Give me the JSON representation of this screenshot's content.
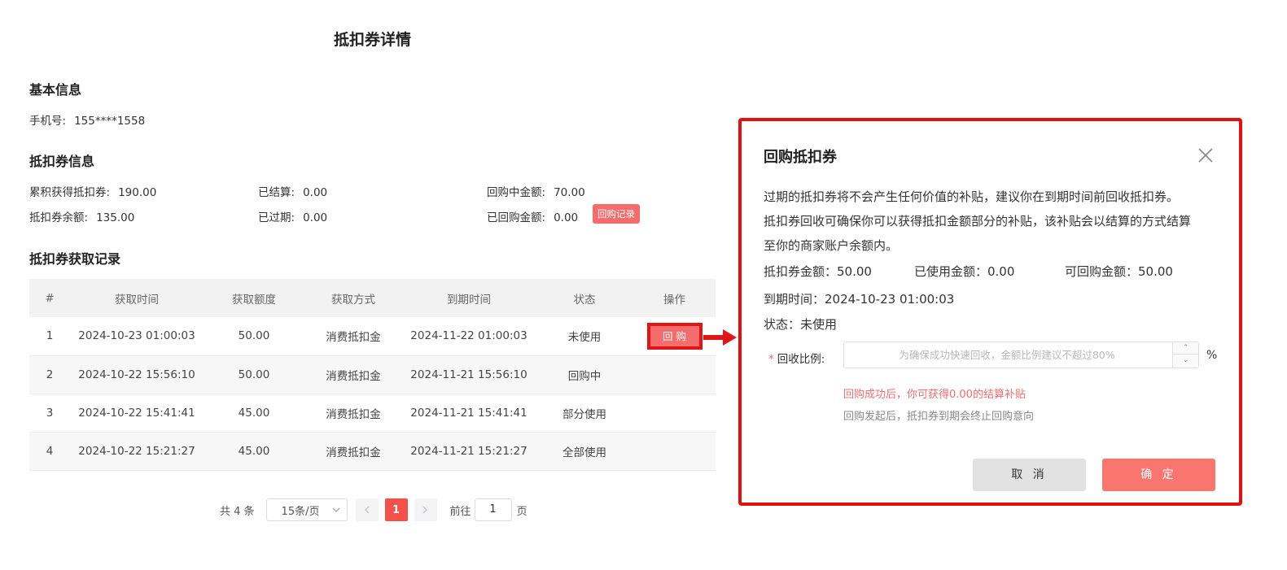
{
  "page": {
    "title": "抵扣券详情"
  },
  "basic": {
    "title": "基本信息",
    "phone_label": "手机号:",
    "phone_value": "155****1558"
  },
  "coupon_info": {
    "title": "抵扣券信息",
    "total_label": "累积获得抵扣券:",
    "total_value": "190.00",
    "settled_label": "已结算:",
    "settled_value": "0.00",
    "buyback_pending_label": "回购中金额:",
    "buyback_pending_value": "70.00",
    "balance_label": "抵扣券余额:",
    "balance_value": "135.00",
    "expired_label": "已过期:",
    "expired_value": "0.00",
    "bought_back_label": "已回购金额:",
    "bought_back_value": "0.00",
    "buyback_record_button": "回购记录"
  },
  "records": {
    "title": "抵扣券获取记录",
    "columns": [
      "#",
      "获取时间",
      "获取额度",
      "获取方式",
      "到期时间",
      "状态",
      "操作"
    ],
    "rows": [
      {
        "index": "1",
        "time": "2024-10-23 01:00:03",
        "amount": "50.00",
        "method": "消费抵扣金",
        "expire": "2024-11-22 01:00:03",
        "status": "未使用",
        "action": "回 购"
      },
      {
        "index": "2",
        "time": "2024-10-22 15:56:10",
        "amount": "50.00",
        "method": "消费抵扣金",
        "expire": "2024-11-21 15:56:10",
        "status": "回购中",
        "action": ""
      },
      {
        "index": "3",
        "time": "2024-10-22 15:41:41",
        "amount": "45.00",
        "method": "消费抵扣金",
        "expire": "2024-11-21 15:41:41",
        "status": "部分使用",
        "action": ""
      },
      {
        "index": "4",
        "time": "2024-10-22 15:21:27",
        "amount": "45.00",
        "method": "消费抵扣金",
        "expire": "2024-11-21 15:21:27",
        "status": "全部使用",
        "action": ""
      }
    ]
  },
  "pagination": {
    "total": "共 4 条",
    "page_size": "15条/页",
    "current_page": "1",
    "goto_label": "前往",
    "goto_value": "1",
    "page_suffix": "页"
  },
  "dialog": {
    "title": "回购抵扣券",
    "desc_line1": "过期的抵扣券将不会产生任何价值的补贴，建议你在到期时间前回收抵扣券。",
    "desc_line2": "抵扣券回收可确保你可以获得抵扣金额部分的补贴，该补贴会以结算的方式结算",
    "desc_line3": "至你的商家账户余额内。",
    "coupon_amount": "抵扣券金额：50.00",
    "used_amount": "已使用金额：0.00",
    "buyback_amount": "可回购金额：50.00",
    "expire_time": "到期时间：2024-10-23 01:00:03",
    "status": "状态：未使用",
    "required_mark": "*",
    "ratio_label": "回收比例:",
    "ratio_placeholder": "为确保成功快速回收，金额比例建议不超过80%",
    "ratio_value": "",
    "percent_sign": "%",
    "tip_success": "回购成功后，你可获得0.00的结算补贴",
    "tip_terminate": "回购发起后，抵扣券到期会终止回购意向",
    "cancel": "取 消",
    "confirm": "确 定"
  },
  "colors": {
    "accent_red": "#f56c6c",
    "highlight_border": "#e50f0f",
    "confirm_button": "#f9766f"
  }
}
